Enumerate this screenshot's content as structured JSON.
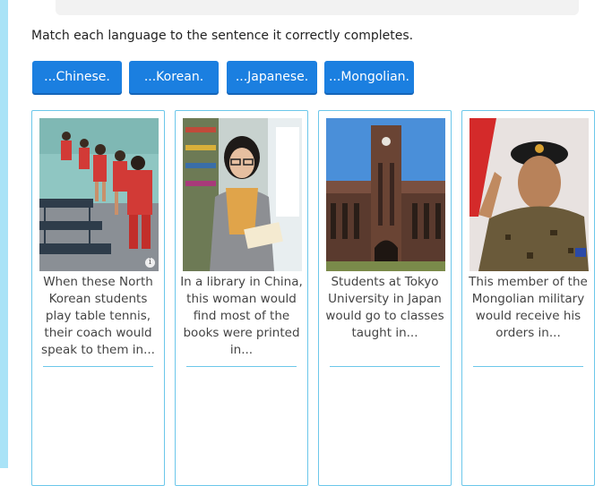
{
  "instruction": "Match each language to the sentence it correctly completes.",
  "answers": [
    {
      "label": "...Chinese."
    },
    {
      "label": "...Korean."
    },
    {
      "label": "...Japanese."
    },
    {
      "label": "...Mongolian."
    }
  ],
  "cards": [
    {
      "caption": "When these North Korean students play table tennis, their coach would speak to them in...",
      "image": "table-tennis-students-photo",
      "info_icon": "i"
    },
    {
      "caption": "In a library in China, this woman would find most of the books were printed in...",
      "image": "library-woman-photo"
    },
    {
      "caption": "Students at Tokyo University in Japan would go to classes taught in...",
      "image": "tokyo-university-photo"
    },
    {
      "caption": "This member of the Mongolian military would receive his orders in...",
      "image": "mongolian-soldier-photo"
    }
  ],
  "colors": {
    "accent": "#1b7fe0",
    "card_border": "#6cc7ea",
    "left_strip": "#a9e3f7"
  }
}
